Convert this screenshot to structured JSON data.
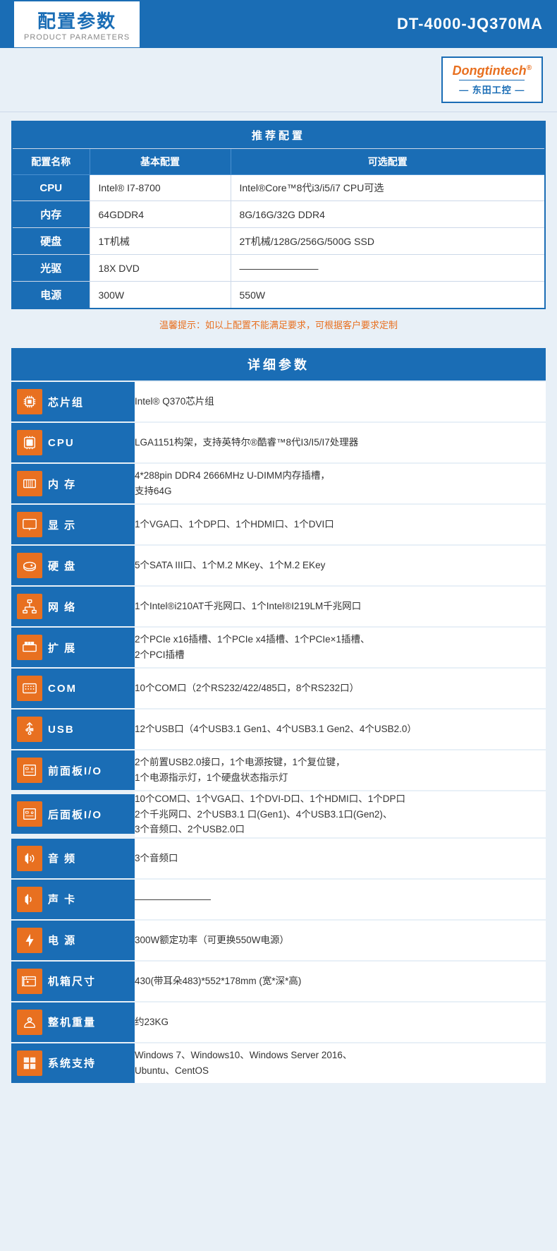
{
  "header": {
    "title_main": "配置参数",
    "title_sub": "PRODUCT PARAMETERS",
    "model": "DT-4000-JQ370MA"
  },
  "logo": {
    "brand_main": "Dongtintech",
    "brand_reg": "®",
    "brand_sub": "— 东田工控 —"
  },
  "recommend": {
    "section_title": "推荐配置",
    "col1": "配置名称",
    "col2": "基本配置",
    "col3": "可选配置",
    "rows": [
      {
        "name": "CPU",
        "basic": "Intel® I7-8700",
        "optional": "Intel®Core™8代i3/i5/i7 CPU可选"
      },
      {
        "name": "内存",
        "basic": "64GDDR4",
        "optional": "8G/16G/32G DDR4"
      },
      {
        "name": "硬盘",
        "basic": "1T机械",
        "optional": "2T机械/128G/256G/500G SSD"
      },
      {
        "name": "光驱",
        "basic": "18X DVD",
        "optional": "————————"
      },
      {
        "name": "电源",
        "basic": "300W",
        "optional": "550W"
      }
    ],
    "notice": "温馨提示：如以上配置不能满足要求，可根据客户要求定制"
  },
  "detail": {
    "section_title": "详细参数",
    "rows": [
      {
        "icon": "🔧",
        "label": "芯片组",
        "value": "Intel® Q370芯片组"
      },
      {
        "icon": "💻",
        "label": "CPU",
        "value": "LGA1151构架，支持英特尔®酷睿™8代I3/I5/I7处理器"
      },
      {
        "icon": "🖥",
        "label": "内 存",
        "value": "4*288pin DDR4 2666MHz U-DIMM内存插槽，\n支持64G"
      },
      {
        "icon": "📺",
        "label": "显 示",
        "value": "1个VGA口、1个DP口、1个HDMI口、1个DVI口"
      },
      {
        "icon": "💾",
        "label": "硬 盘",
        "value": "5个SATA III口、1个M.2 MKey、1个M.2 EKey"
      },
      {
        "icon": "🌐",
        "label": "网 络",
        "value": "1个Intel®i210AT千兆网口、1个Intel®I219LM千兆网口"
      },
      {
        "icon": "🔌",
        "label": "扩 展",
        "value": "2个PCIe x16插槽、1个PCIe x4插槽、1个PCIe×1插槽、\n2个PCI插槽"
      },
      {
        "icon": "🔗",
        "label": "COM",
        "value": "10个COM口（2个RS232/422/485口，8个RS232口）"
      },
      {
        "icon": "🔌",
        "label": "USB",
        "value": "12个USB口（4个USB3.1 Gen1、4个USB3.1 Gen2、4个USB2.0）"
      },
      {
        "icon": "📋",
        "label": "前面板I/O",
        "value": "2个前置USB2.0接口，1个电源按键，1个复位键，\n1个电源指示灯，1个硬盘状态指示灯"
      },
      {
        "icon": "📋",
        "label": "后面板I/O",
        "value": "10个COM口、1个VGA口、1个DVI-D口、1个HDMI口、1个DP口\n2个千兆网口、2个USB3.1 口(Gen1)、4个USB3.1口(Gen2)、\n3个音频口、2个USB2.0口"
      },
      {
        "icon": "🔊",
        "label": "音 频",
        "value": "3个音频口"
      },
      {
        "icon": "🔊",
        "label": "声 卡",
        "value": "————————"
      },
      {
        "icon": "⚡",
        "label": "电 源",
        "value": "300W额定功率（可更换550W电源）"
      },
      {
        "icon": "📦",
        "label": "机箱尺寸",
        "value": "430(带耳朵483)*552*178mm (宽*深*高)"
      },
      {
        "icon": "⚖",
        "label": "整机重量",
        "value": "约23KG"
      },
      {
        "icon": "🪟",
        "label": "系统支持",
        "value": "Windows 7、Windows10、Windows Server 2016、\nUbuntu、CentOS"
      }
    ]
  },
  "icons": {
    "chip": "chip-icon",
    "cpu": "cpu-icon",
    "memory": "memory-icon",
    "display": "display-icon",
    "hdd": "hdd-icon",
    "network": "network-icon",
    "expansion": "expansion-icon",
    "com": "com-icon",
    "usb": "usb-icon",
    "front_io": "front-io-icon",
    "back_io": "back-io-icon",
    "audio": "audio-icon",
    "sound_card": "sound-card-icon",
    "power": "power-icon",
    "chassis": "chassis-icon",
    "weight": "weight-icon",
    "os": "os-icon"
  }
}
